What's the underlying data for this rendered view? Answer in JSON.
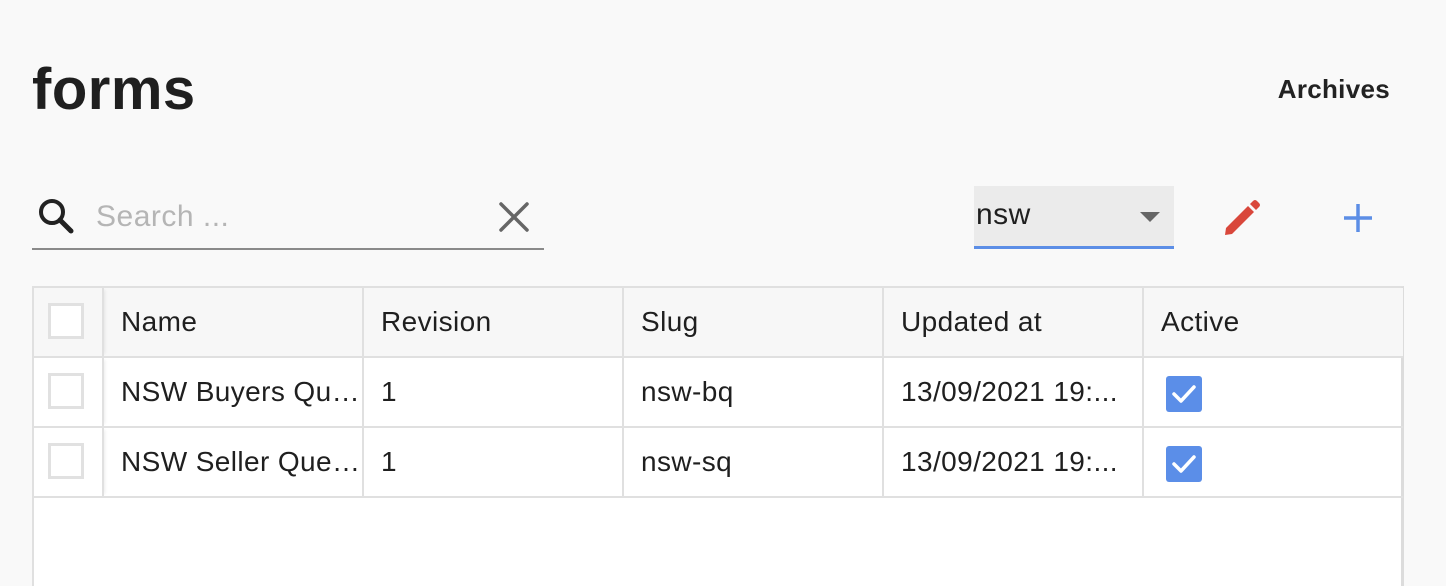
{
  "page": {
    "title": "forms",
    "archives_label": "Archives"
  },
  "toolbar": {
    "search_placeholder": "Search ...",
    "search_value": "",
    "search_icon": "search-icon",
    "clear_icon": "close-icon",
    "filter_value": "nsw",
    "edit_icon": "pencil-icon",
    "add_icon": "plus-icon"
  },
  "colors": {
    "edit_icon": "#d9473b",
    "add_icon": "#5c8ee6",
    "select_underline": "#5c8ee6",
    "active_checkbox": "#5b8ee8"
  },
  "table": {
    "columns": [
      "Name",
      "Revision",
      "Slug",
      "Updated at",
      "Active"
    ],
    "rows": [
      {
        "name": "NSW Buyers Questionnaire",
        "revision": "1",
        "slug": "nsw-bq",
        "updated_at": "13/09/2021 19:...",
        "active": true
      },
      {
        "name": "NSW Seller Questionnaire",
        "revision": "1",
        "slug": "nsw-sq",
        "updated_at": "13/09/2021 19:...",
        "active": true
      }
    ]
  }
}
